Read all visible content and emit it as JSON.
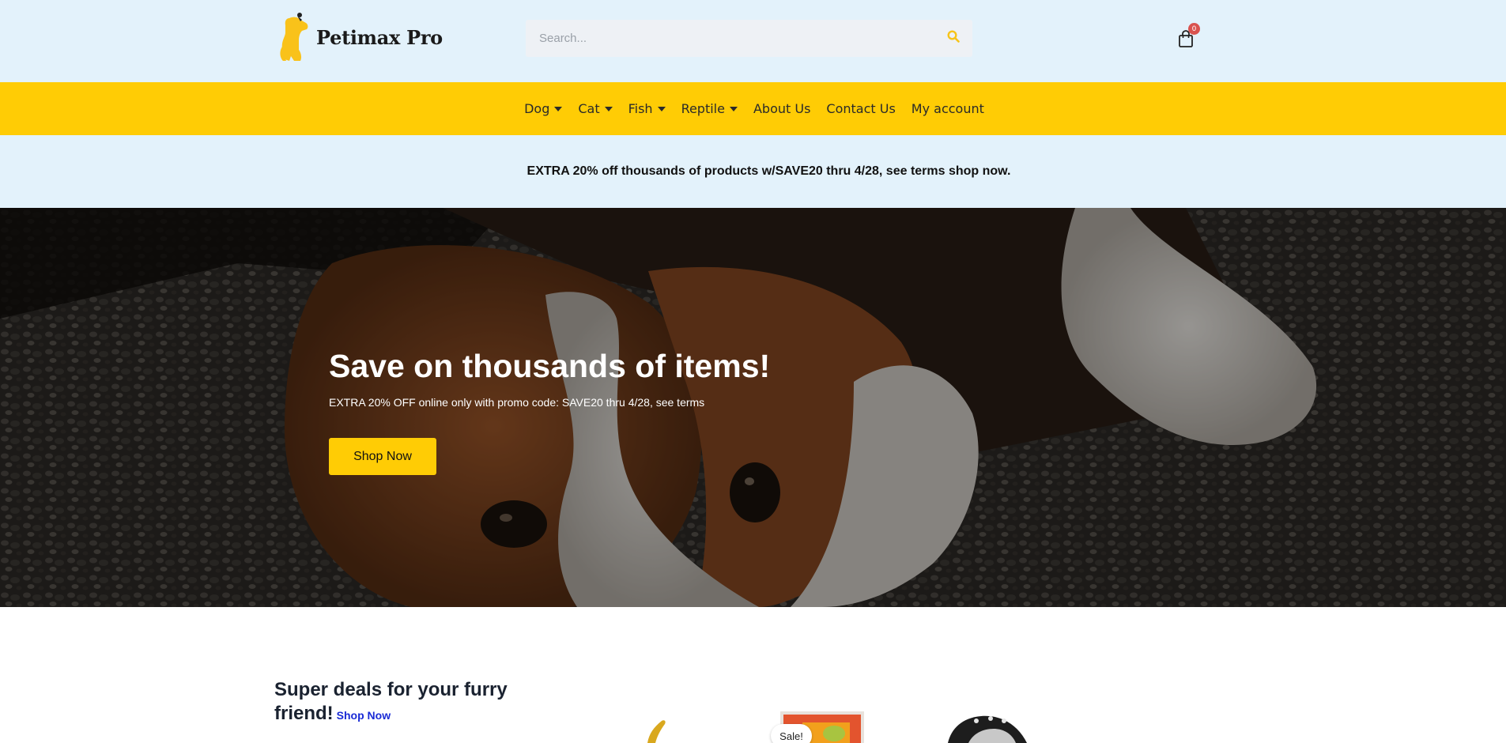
{
  "header": {
    "logo_text": "Petimax Pro",
    "search_placeholder": "Search...",
    "cart_count": "0"
  },
  "nav": {
    "items": [
      {
        "label": "Dog",
        "dropdown": true
      },
      {
        "label": "Cat",
        "dropdown": true
      },
      {
        "label": "Fish",
        "dropdown": true
      },
      {
        "label": "Reptile",
        "dropdown": true
      },
      {
        "label": "About Us",
        "dropdown": false
      },
      {
        "label": "Contact Us",
        "dropdown": false
      },
      {
        "label": "My account",
        "dropdown": false
      }
    ]
  },
  "promo": {
    "text": "EXTRA 20% off thousands of products w/SAVE20 thru 4/28, see terms shop now."
  },
  "hero": {
    "title": "Save on thousands of items!",
    "subtitle": "EXTRA 20% OFF online only with promo code: SAVE20 thru 4/28, see terms",
    "button_label": "Shop Now"
  },
  "deals": {
    "title": "Super deals for your furry friend!",
    "link_label": "Shop Now",
    "sale_badge": "Sale!"
  },
  "colors": {
    "header_bg": "#e3f2fb",
    "nav_bg": "#ffcc05",
    "accent": "#ffcc05",
    "badge": "#d9534f",
    "link": "#1a2bd6"
  },
  "icons": [
    "dog-logo-icon",
    "search-icon",
    "shopping-bag-icon",
    "caret-down-icon"
  ]
}
